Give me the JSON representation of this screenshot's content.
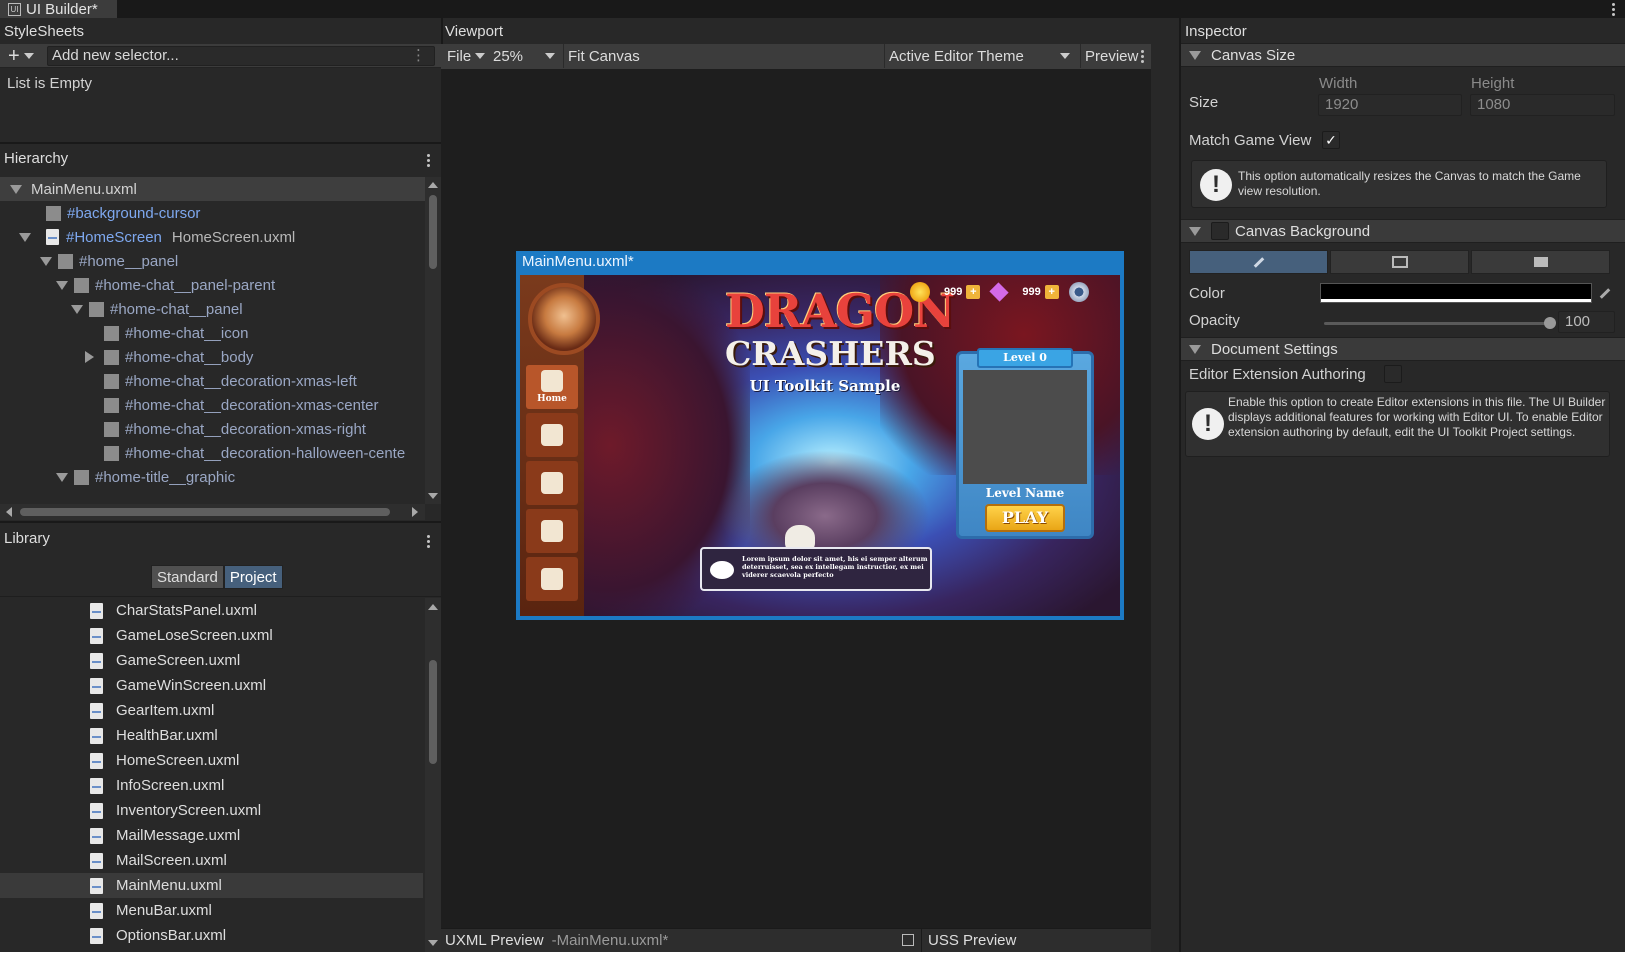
{
  "window": {
    "tab_title": "UI Builder*"
  },
  "stylesheets": {
    "title": "StyleSheets",
    "add_placeholder": "Add new selector...",
    "empty_text": "List is Empty"
  },
  "hierarchy": {
    "title": "Hierarchy",
    "rows": [
      {
        "name": "MainMenu.uxml",
        "extra": ""
      },
      {
        "name": "#background-cursor",
        "extra": ""
      },
      {
        "name": "#HomeScreen",
        "extra": "HomeScreen.uxml"
      },
      {
        "name": "#home__panel",
        "extra": ""
      },
      {
        "name": "#home-chat__panel-parent",
        "extra": ""
      },
      {
        "name": "#home-chat__panel",
        "extra": ""
      },
      {
        "name": "#home-chat__icon",
        "extra": ""
      },
      {
        "name": "#home-chat__body",
        "extra": ""
      },
      {
        "name": "#home-chat__decoration-xmas-left",
        "extra": ""
      },
      {
        "name": "#home-chat__decoration-xmas-center",
        "extra": ""
      },
      {
        "name": "#home-chat__decoration-xmas-right",
        "extra": ""
      },
      {
        "name": "#home-chat__decoration-halloween-cente",
        "extra": ""
      },
      {
        "name": "#home-title__graphic",
        "extra": ""
      }
    ]
  },
  "library": {
    "title": "Library",
    "tabs": [
      "Standard",
      "Project"
    ],
    "active_tab": "Project",
    "items": [
      "CharStatsPanel.uxml",
      "GameLoseScreen.uxml",
      "GameScreen.uxml",
      "GameWinScreen.uxml",
      "GearItem.uxml",
      "HealthBar.uxml",
      "HomeScreen.uxml",
      "InfoScreen.uxml",
      "InventoryScreen.uxml",
      "MailMessage.uxml",
      "MailScreen.uxml",
      "MainMenu.uxml",
      "MenuBar.uxml",
      "OptionsBar.uxml"
    ],
    "highlighted_item": "MainMenu.uxml"
  },
  "viewport": {
    "title": "Viewport",
    "file_menu": "File",
    "zoom": "25%",
    "fit_canvas": "Fit Canvas",
    "theme": "Active Editor Theme",
    "preview": "Preview",
    "canvas_title": "MainMenu.uxml*",
    "game": {
      "logo_line1": "DRAGON",
      "logo_line2": "CRASHERS",
      "subtitle": "UI Toolkit Sample",
      "coins": "999",
      "gems": "999",
      "home_label": "Home",
      "level_label": "Level 0",
      "level_name": "Level Name",
      "play_button": "PLAY",
      "chat_text": "Lorem ipsum dolor sit amet, his ei semper alterum deterruisset, sea ex intellegam instructior, ex mei viderer scaevola perfecto"
    }
  },
  "preview_bar": {
    "uxml_label": "UXML Preview",
    "uxml_file": "-MainMenu.uxml*",
    "uss_label": "USS Preview"
  },
  "inspector": {
    "title": "Inspector",
    "canvas_size": {
      "header": "Canvas Size",
      "size_label": "Size",
      "width_label": "Width",
      "height_label": "Height",
      "width": "1920",
      "height": "1080",
      "match_label": "Match Game View",
      "match_checked": true,
      "help": "This option automatically resizes the Canvas to match the Game view resolution."
    },
    "canvas_background": {
      "header": "Canvas Background",
      "color_label": "Color",
      "color_value": "#000000",
      "opacity_label": "Opacity",
      "opacity_value": "100",
      "opacity_fraction": 1.0
    },
    "document_settings": {
      "header": "Document Settings",
      "authoring_label": "Editor Extension Authoring",
      "help": "Enable this option to create Editor extensions in this file. The UI Builder displays additional features for working with Editor UI. To enable Editor extension authoring by default, edit the UI Toolkit Project settings."
    }
  },
  "colors": {
    "accent_blue": "#46607c",
    "selection_text": "#7ea8ef",
    "canvas_frame": "#1c7ac4"
  }
}
